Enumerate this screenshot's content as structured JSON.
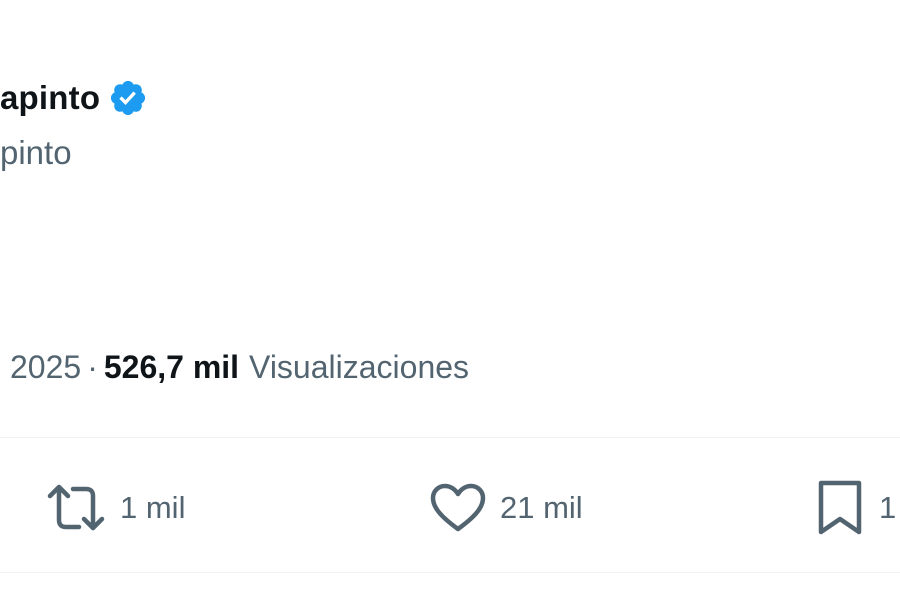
{
  "tweet": {
    "display_name": "apinto",
    "handle": "pinto",
    "verified_icon": "verified-badge-icon",
    "meta": {
      "date": "2025",
      "separator": "·",
      "views_count": "526,7 mil",
      "views_label": "Visualizaciones"
    },
    "actions": {
      "retweet": {
        "icon": "retweet-icon",
        "count": "1 mil"
      },
      "like": {
        "icon": "heart-icon",
        "count": "21 mil"
      },
      "bookmark": {
        "icon": "bookmark-icon",
        "count": "1"
      }
    }
  },
  "colors": {
    "text_primary": "#0f1419",
    "text_secondary": "#536471",
    "verified_blue": "#1d9bf0",
    "divider": "#eff3f4",
    "background": "#ffffff"
  }
}
